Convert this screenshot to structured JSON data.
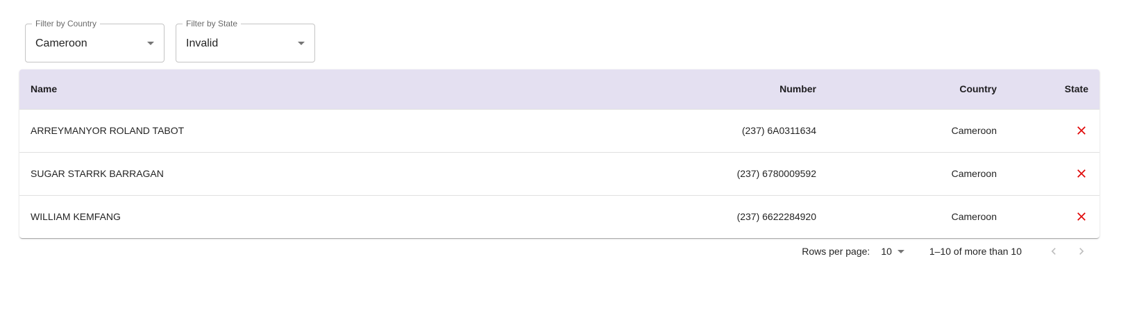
{
  "filters": {
    "country": {
      "label": "Filter by Country",
      "value": "Cameroon"
    },
    "state": {
      "label": "Filter by State",
      "value": "Invalid"
    }
  },
  "table": {
    "headers": {
      "name": "Name",
      "number": "Number",
      "country": "Country",
      "state": "State"
    },
    "rows": [
      {
        "name": "ARREYMANYOR ROLAND TABOT",
        "number": "(237) 6A0311634",
        "country": "Cameroon",
        "state_icon": "close-x-icon"
      },
      {
        "name": "SUGAR STARRK BARRAGAN",
        "number": "(237) 6780009592",
        "country": "Cameroon",
        "state_icon": "close-x-icon"
      },
      {
        "name": "WILLIAM KEMFANG",
        "number": "(237) 6622284920",
        "country": "Cameroon",
        "state_icon": "close-x-icon"
      }
    ]
  },
  "pagination": {
    "rows_per_page_label": "Rows per page:",
    "rows_per_page_value": "10",
    "range_text": "1–10 of more than 10"
  },
  "colors": {
    "header_bg": "#e4e0f1",
    "invalid_red": "#e00000",
    "nav_disabled": "#bdbdbd"
  }
}
